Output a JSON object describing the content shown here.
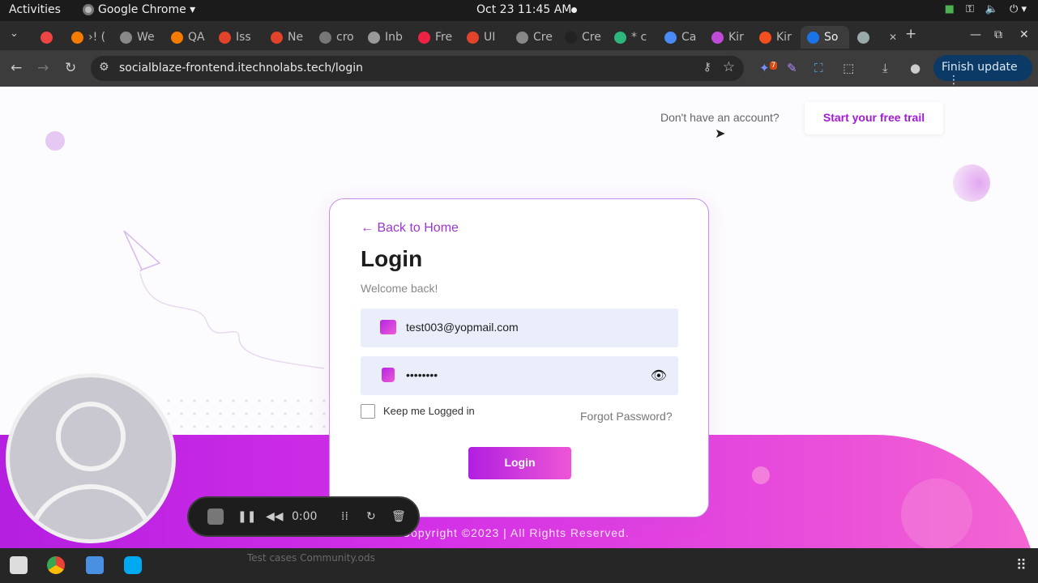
{
  "system_bar": {
    "activities": "Activities",
    "app_name": "Google Chrome ▾",
    "datetime": "Oct 23  11:45 AM"
  },
  "tabs": [
    {
      "label": "",
      "color": "#e44"
    },
    {
      "label": "›! (",
      "color": "#f57c00"
    },
    {
      "label": "We",
      "color": "#888"
    },
    {
      "label": "QA",
      "color": "#f57c00"
    },
    {
      "label": "Iss",
      "color": "#e2432a"
    },
    {
      "label": "Ne",
      "color": "#e2432a"
    },
    {
      "label": "cro",
      "color": "#777"
    },
    {
      "label": "Inb",
      "color": "#999"
    },
    {
      "label": "Fre",
      "color": "#e24"
    },
    {
      "label": "UI",
      "color": "#e2432a"
    },
    {
      "label": "Cre",
      "color": "#888"
    },
    {
      "label": "Cre",
      "color": "#222"
    },
    {
      "label": "* c",
      "color": "#2eb67d"
    },
    {
      "label": "Ca",
      "color": "#4a8bf5"
    },
    {
      "label": "Kir",
      "color": "#c04bd9"
    },
    {
      "label": "Kir",
      "color": "#f24e1e"
    },
    {
      "label": "So",
      "color": "#1a73e8"
    },
    {
      "label": "",
      "color": "#9aa"
    }
  ],
  "browser": {
    "url": "socialblaze-frontend.itechnolabs.tech/login",
    "finish_update": "Finish update",
    "ext_badge": "7"
  },
  "page": {
    "no_account": "Don't have an account?",
    "trial_button": "Start your free trail",
    "back_link": "← Back to Home",
    "title": "Login",
    "welcome": "Welcome back!",
    "email_value": "test003@yopmail.com",
    "password_mask": "••••••••",
    "keep_logged_in": "Keep me Logged in",
    "forgot_password": "Forgot Password?",
    "login_button": "Login",
    "copyright": "Copyright ©2023 | All Rights Reserved."
  },
  "recorder": {
    "time": "0:00"
  },
  "taskbar": {
    "file_hint": "Test cases Community.ods"
  },
  "colors": {
    "accent": "#a21ad6",
    "gradient_start": "#b01fe1",
    "gradient_end": "#ee56d6",
    "finish_update_bg": "#0b3a66"
  }
}
